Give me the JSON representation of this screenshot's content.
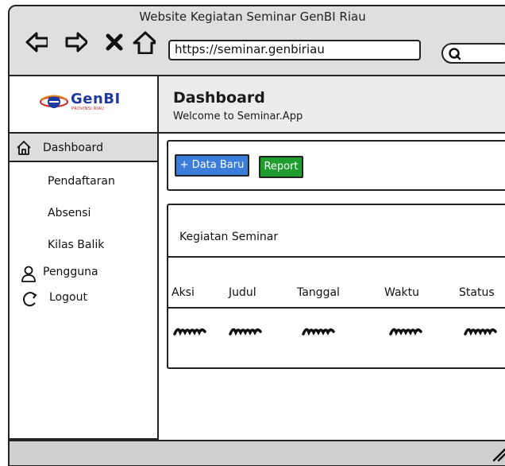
{
  "window": {
    "title": "Website Kegiatan Seminar GenBI Riau",
    "url": "https://seminar.genbiriau",
    "search_placeholder": ""
  },
  "sidebar": {
    "logo_text": "GenBI",
    "logo_sub": "PROVINSI RIAU",
    "items": [
      {
        "label": "Dashboard",
        "icon": "home-icon"
      },
      {
        "label": "Pendaftaran",
        "icon": ""
      },
      {
        "label": "Absensi",
        "icon": ""
      },
      {
        "label": "Kilas Balik",
        "icon": ""
      },
      {
        "label": "Pengguna",
        "icon": "user-icon"
      },
      {
        "label": "Logout",
        "icon": "logout-icon"
      }
    ]
  },
  "header": {
    "title": "Dashboard",
    "subtitle": "Welcome to Seminar.App"
  },
  "toolbar": {
    "new_label": "+ Data Baru",
    "report_label": "Report"
  },
  "table": {
    "title": "Kegiatan Seminar",
    "columns": [
      "Aksi",
      "Judul",
      "Tanggal",
      "Waktu",
      "Status"
    ]
  },
  "colors": {
    "blue_button": "#3b7dd8",
    "green_button": "#1f9d2e",
    "logo_blue": "#1e3a9e"
  }
}
